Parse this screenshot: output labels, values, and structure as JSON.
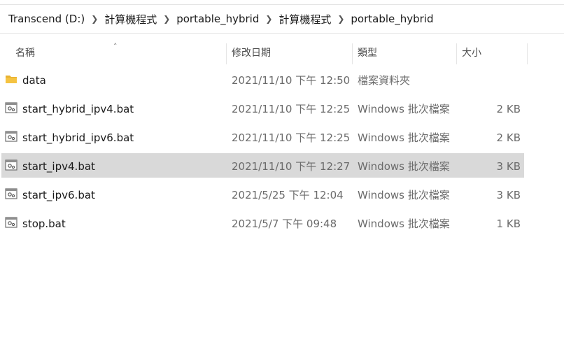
{
  "breadcrumb": [
    "Transcend (D:)",
    "計算機程式",
    "portable_hybrid",
    "計算機程式",
    "portable_hybrid"
  ],
  "columns": {
    "name": "名稱",
    "date": "修改日期",
    "type": "類型",
    "size": "大小"
  },
  "files": [
    {
      "name": "data",
      "date": "2021/11/10 下午 12:50",
      "type": "檔案資料夾",
      "size": "",
      "icon": "folder-icon",
      "selected": false
    },
    {
      "name": "start_hybrid_ipv4.bat",
      "date": "2021/11/10 下午 12:25",
      "type": "Windows 批次檔案",
      "size": "2 KB",
      "icon": "batch-file-icon",
      "selected": false
    },
    {
      "name": "start_hybrid_ipv6.bat",
      "date": "2021/11/10 下午 12:25",
      "type": "Windows 批次檔案",
      "size": "2 KB",
      "icon": "batch-file-icon",
      "selected": false
    },
    {
      "name": "start_ipv4.bat",
      "date": "2021/11/10 下午 12:27",
      "type": "Windows 批次檔案",
      "size": "3 KB",
      "icon": "batch-file-icon",
      "selected": true
    },
    {
      "name": "start_ipv6.bat",
      "date": "2021/5/25 下午 12:04",
      "type": "Windows 批次檔案",
      "size": "3 KB",
      "icon": "batch-file-icon",
      "selected": false
    },
    {
      "name": "stop.bat",
      "date": "2021/5/7 下午 09:48",
      "type": "Windows 批次檔案",
      "size": "1 KB",
      "icon": "batch-file-icon",
      "selected": false
    }
  ],
  "colors": {
    "selected_row": "#d9d9d9",
    "folder": "#f5c342"
  }
}
